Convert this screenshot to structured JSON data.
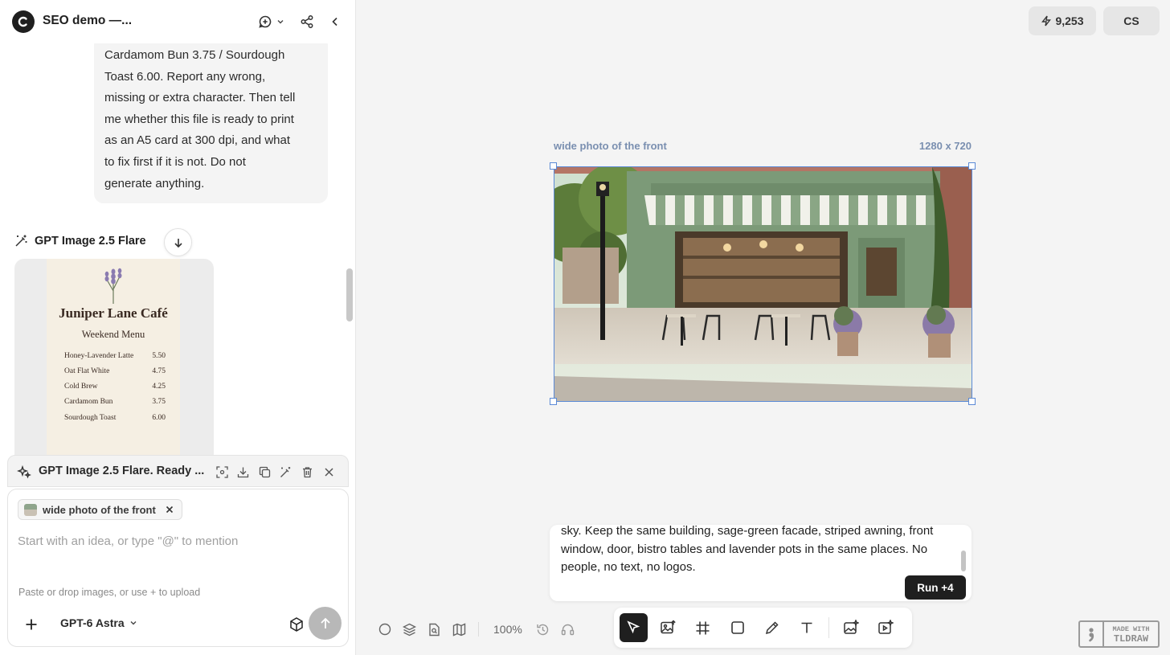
{
  "header": {
    "project_title": "SEO demo —..."
  },
  "chat": {
    "user_message": "Cardamom Bun 3.75 / Sourdough\nToast 6.00. Report any wrong,\nmissing or extra character. Then tell\nme whether this file is ready to print\nas an A5 card at 300 dpi, and what\nto fix first if it is not. Do not\ngenerate anything.",
    "generation_label": "GPT Image 2.5 Flare",
    "menu_image": {
      "title": "Juniper Lane Café",
      "subtitle": "Weekend Menu",
      "items": [
        {
          "name": "Honey-Lavender Latte",
          "price": "5.50"
        },
        {
          "name": "Oat Flat White",
          "price": "4.75"
        },
        {
          "name": "Cold Brew",
          "price": "4.25"
        },
        {
          "name": "Cardamom Bun",
          "price": "3.75"
        },
        {
          "name": "Sourdough Toast",
          "price": "6.00"
        }
      ]
    }
  },
  "selection_panel": {
    "title": "GPT Image 2.5 Flare. Ready ..."
  },
  "composer": {
    "chip_label": "wide photo of the front",
    "placeholder": "Start with an idea, or type \"@\" to mention",
    "value": "",
    "hint": "Paste or drop images, or use + to upload",
    "model": "GPT-6 Astra"
  },
  "topbar": {
    "credits": "9,253",
    "user_initials": "CS"
  },
  "canvas": {
    "frame_label": "wide photo of the front",
    "frame_size": "1280 x 720",
    "edit_prompt": "sky. Keep the same building, sage-green facade, striped awning, front window, door, bistro tables and lavender pots in the same places. No people, no text, no logos.",
    "run_label": "Run +4",
    "zoom": "100%"
  },
  "watermark": {
    "line1": "MADE WITH",
    "line2": "TLDRAW"
  },
  "colors": {
    "accent": "#5b8ad6",
    "dark": "#1f1f1f",
    "facade": "#7c9a78"
  }
}
